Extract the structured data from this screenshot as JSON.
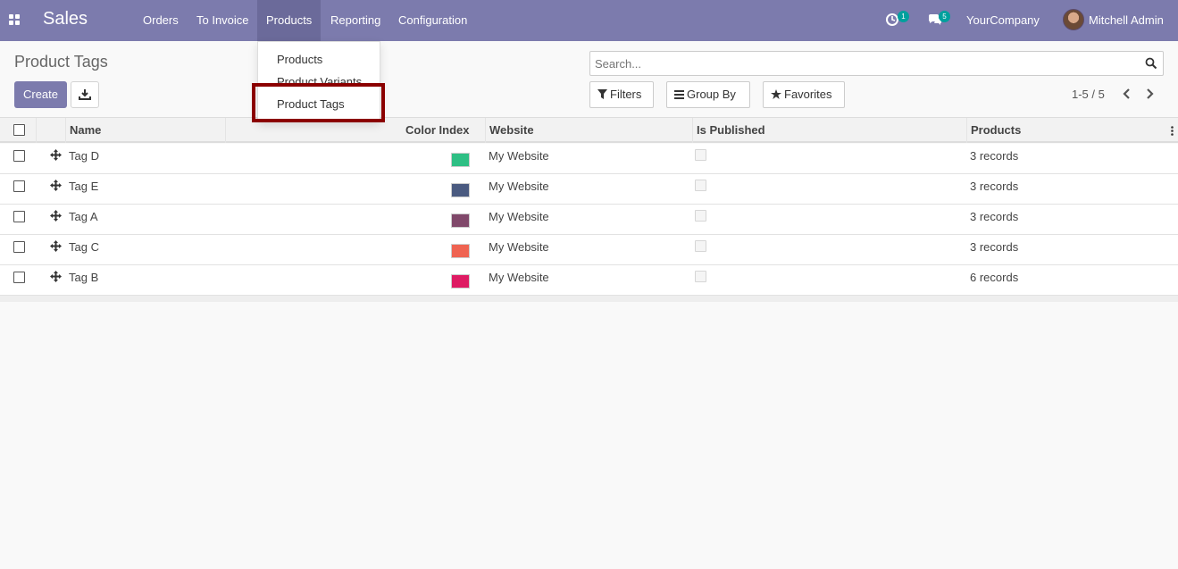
{
  "navbar": {
    "app_name": "Sales",
    "menu": [
      "Orders",
      "To Invoice",
      "Products",
      "Reporting",
      "Configuration"
    ],
    "activities_badge": "1",
    "messages_badge": "5",
    "company": "YourCompany",
    "user": "Mitchell Admin"
  },
  "dropdown": {
    "items": [
      "Products",
      "Product Variants",
      "Product Tags"
    ]
  },
  "control_panel": {
    "title": "Product Tags",
    "create_label": "Create",
    "search_placeholder": "Search...",
    "filters_label": "Filters",
    "group_by_label": "Group By",
    "favorites_label": "Favorites",
    "pager": "1-5 / 5"
  },
  "table": {
    "headers": {
      "name": "Name",
      "color_index": "Color Index",
      "website": "Website",
      "is_published": "Is Published",
      "products": "Products"
    },
    "rows": [
      {
        "name": "Tag D",
        "color": "#2ebf84",
        "website": "My Website",
        "products": "3 records"
      },
      {
        "name": "Tag E",
        "color": "#4a5a80",
        "website": "My Website",
        "products": "3 records"
      },
      {
        "name": "Tag A",
        "color": "#80486a",
        "website": "My Website",
        "products": "3 records"
      },
      {
        "name": "Tag C",
        "color": "#ef6351",
        "website": "My Website",
        "products": "3 records"
      },
      {
        "name": "Tag B",
        "color": "#de1b63",
        "website": "My Website",
        "products": "6 records"
      }
    ]
  },
  "colors": {
    "brand": "#7c7bad",
    "highlight": "#8b0000",
    "badge": "#00a09d"
  }
}
